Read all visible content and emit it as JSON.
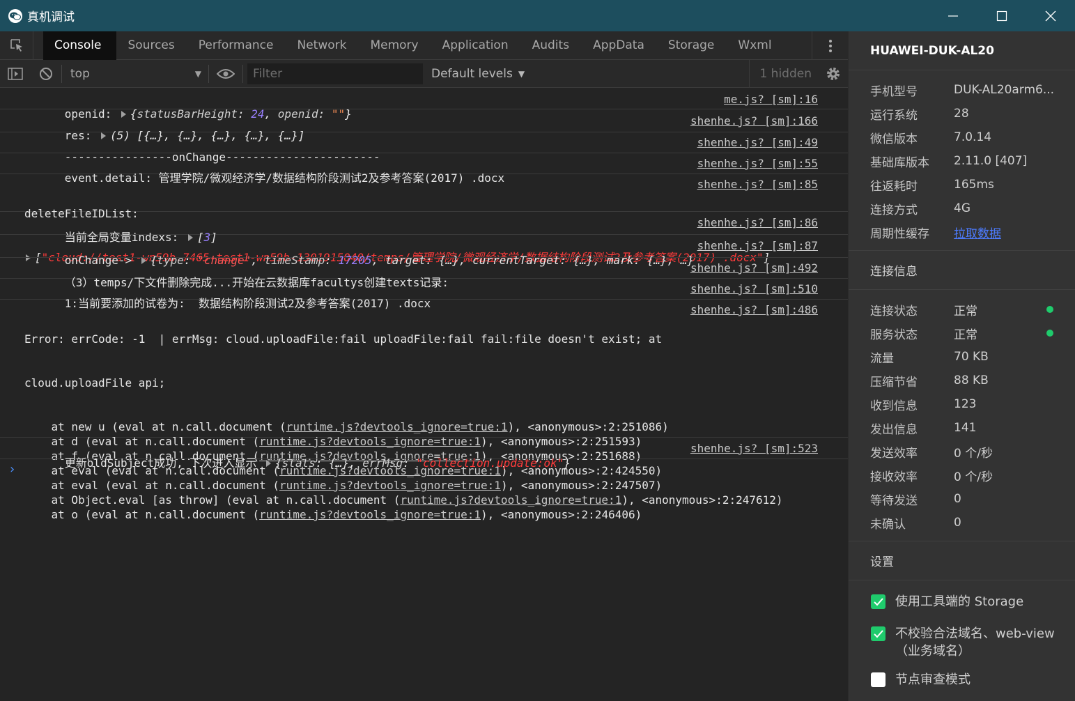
{
  "window": {
    "title": "真机调试"
  },
  "tabs": [
    "Console",
    "Sources",
    "Performance",
    "Network",
    "Memory",
    "Application",
    "Audits",
    "AppData",
    "Storage",
    "Wxml"
  ],
  "toolbar": {
    "context": "top",
    "filter_placeholder": "Filter",
    "levels": "Default levels",
    "hidden": "1 hidden"
  },
  "console": {
    "m1": {
      "pre": "openid: ",
      "k1": "statusBarHeight",
      "v1": "24",
      "k2": "openid",
      "v2": "\"\"",
      "src": "me.js? [sm]:16"
    },
    "m2": {
      "pre": "res: ",
      "body": "(5) [{…}, {…}, {…}, {…}, {…}]",
      "src": "shenhe.js? [sm]:166"
    },
    "m3": {
      "text": "----------------onChange-----------------------",
      "src": "shenhe.js? [sm]:49"
    },
    "m4": {
      "text": "event.detail: 管理学院/微观经济学/数据结构阶段测试2及参考答案(2017) .docx",
      "src": "shenhe.js? [sm]:55"
    },
    "m5": {
      "text": "deleteFileIDList:",
      "value": "\"cloud://test1-wn59b.7465-test1-wn59b-1301915040/temps/管理学院/微观经济学/数据结构阶段测试2及参考答案(2017) .docx\"",
      "src": "shenhe.js? [sm]:85"
    },
    "m6": {
      "pre": "当前全局变量indexs: ",
      "body": "3",
      "src": "shenhe.js? [sm]:86"
    },
    "m7": {
      "pre": "onChange-> ",
      "k1": "type",
      "v1": "\"change\"",
      "k2": "timeStamp",
      "v2": "17205",
      "rest": ", target: {…}, currentTarget: {…}, mark: {…}, …}",
      "src": "shenhe.js? [sm]:87"
    },
    "m8": {
      "text": "（3）temps/下文件删除完成...开始在云数据库facultys创建texts记录:",
      "src": "shenhe.js? [sm]:492"
    },
    "m9": {
      "text": "1:当前要添加的试卷为:  数据结构阶段测试2及参考答案(2017) .docx",
      "src": "shenhe.js? [sm]:510"
    },
    "m10": {
      "line1": "Error: errCode: -1  | errMsg: cloud.uploadFile:fail uploadFile:fail fail:file doesn't exist; at",
      "line2": "cloud.uploadFile api;",
      "src": "shenhe.js? [sm]:486",
      "link": "runtime.js?devtools_ignore=true:1",
      "stack": [
        {
          "pre": "    at new u (eval at n.call.document (",
          "post": "), <anonymous>:2:251086)"
        },
        {
          "pre": "    at d (eval at n.call.document (",
          "post": "), <anonymous>:2:251593)"
        },
        {
          "pre": "    at f (eval at n.call.document (",
          "post": "), <anonymous>:2:251688)"
        },
        {
          "pre": "    at eval (eval at n.call.document (",
          "post": "), <anonymous>:2:424550)"
        },
        {
          "pre": "    at eval (eval at n.call.document (",
          "post": "), <anonymous>:2:247507)"
        },
        {
          "pre": "    at Object.eval [as throw] (eval at n.call.document (",
          "post": "), <anonymous>:2:247612)"
        },
        {
          "pre": "    at o (eval at n.call.document (",
          "post": "), <anonymous>:2:246406)"
        }
      ]
    },
    "m11": {
      "pre": "更新oldSubject成功, 下次进入显示 ",
      "k1": "stats",
      "rest1": ": {…}, ",
      "k2": "errMsg",
      "v2": "\"collection.update:ok\"",
      "src": "shenhe.js? [sm]:523"
    },
    "prompt": "›"
  },
  "device": {
    "name": "HUAWEI-DUK-AL20",
    "info": [
      {
        "k": "手机型号",
        "v": "DUK-AL20arm6..."
      },
      {
        "k": "运行系统",
        "v": "28"
      },
      {
        "k": "微信版本",
        "v": "7.0.14"
      },
      {
        "k": "基础库版本",
        "v": "2.11.0 [407]"
      },
      {
        "k": "往返耗时",
        "v": "165ms"
      },
      {
        "k": "连接方式",
        "v": "4G"
      },
      {
        "k": "周期性缓存",
        "v": "拉取数据"
      }
    ],
    "conn_title": "连接信息",
    "conn": [
      {
        "k": "连接状态",
        "v": "正常"
      },
      {
        "k": "服务状态",
        "v": "正常"
      },
      {
        "k": "流量",
        "v": "70 KB"
      },
      {
        "k": "压缩节省",
        "v": "88 KB"
      },
      {
        "k": "收到信息",
        "v": "123"
      },
      {
        "k": "发出信息",
        "v": "141"
      },
      {
        "k": "发送效率",
        "v": "0 个/秒"
      },
      {
        "k": "接收效率",
        "v": "0 个/秒"
      },
      {
        "k": "等待发送",
        "v": "0"
      },
      {
        "k": "未确认",
        "v": "0"
      }
    ],
    "settings_title": "设置",
    "settings": [
      {
        "label": "使用工具端的 Storage",
        "checked": true
      },
      {
        "label": "不校验合法域名、web-view（业务域名）",
        "checked": true
      },
      {
        "label": "节点审查模式",
        "checked": false
      }
    ]
  },
  "colors": {
    "titlebar": "#1d4e5e",
    "accent_green": "#1fcb6c",
    "link_blue": "#4d7cff",
    "string_red": "#ff3b3b",
    "number_purple": "#9980ff"
  }
}
